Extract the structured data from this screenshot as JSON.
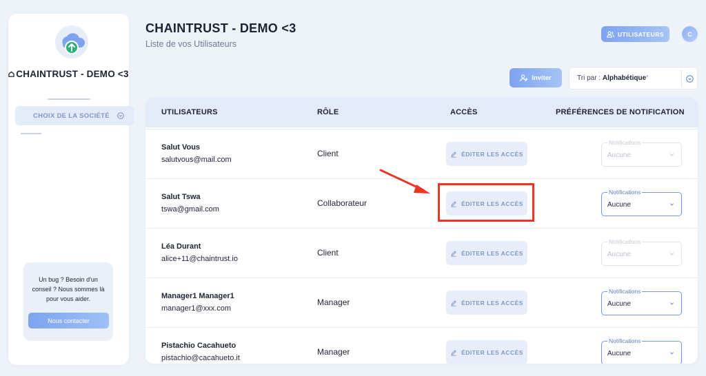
{
  "sidebar": {
    "company_name": "CHAINTRUST - DEMO <3",
    "choose_company_label": "CHOIX DE LA SOCIÉTÉ",
    "help_text": "Un bug ? Besoin d'un conseil ? Nous sommes là pour vous aider.",
    "contact_button": "Nous contacter"
  },
  "header": {
    "title": "CHAINTRUST - DEMO <3",
    "subtitle": "Liste de vos Utilisateurs",
    "users_button": "UTILISATEURS",
    "avatar_initial": "C"
  },
  "toolbar": {
    "invite_button": "Inviter",
    "sort_prefix": "Tri par :",
    "sort_value": "Alphabétique",
    "sort_marker": "*"
  },
  "table": {
    "headers": [
      "UTILISATEURS",
      "RÔLE",
      "ACCÈS",
      "PRÉFÉRENCES DE NOTIFICATION"
    ],
    "edit_label": "ÉDITER LES ACCÈS",
    "notif_label": "Notifications",
    "rows": [
      {
        "name": "Salut Vous",
        "email": "salutvous@mail.com",
        "role": "Client",
        "notification": "Aucune",
        "notif_enabled": false
      },
      {
        "name": "Salut Tswa",
        "email": "tswa@gmail.com",
        "role": "Collaborateur",
        "notification": "Aucune",
        "notif_enabled": true
      },
      {
        "name": "Léa Durant",
        "email": "alice+11@chaintrust.io",
        "role": "Client",
        "notification": "Aucune",
        "notif_enabled": false
      },
      {
        "name": "Manager1 Manager1",
        "email": "manager1@xxx.com",
        "role": "Manager",
        "notification": "Aucune",
        "notif_enabled": true
      },
      {
        "name": "Pistachio Cacahueto",
        "email": "pistachio@cacahueto.it",
        "role": "Manager",
        "notification": "Aucune",
        "notif_enabled": true
      }
    ]
  },
  "colors": {
    "accent": "#7da3f0",
    "annotation": "#ee3524",
    "header_bg": "#e4ebf8"
  },
  "icons": [
    "cloud-upload-icon",
    "home-icon",
    "chevron-circle-icon",
    "users-icon",
    "add-user-icon",
    "pencil-icon",
    "chevron-down-icon"
  ]
}
